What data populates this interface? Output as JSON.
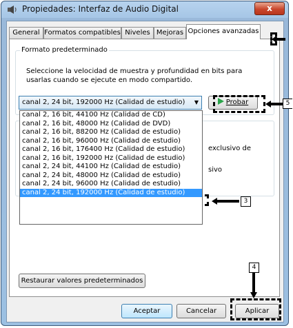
{
  "window": {
    "title": "Propiedades: Interfaz de Audio Digital",
    "close_label": "x"
  },
  "tabs": [
    {
      "label": "General",
      "active": false
    },
    {
      "label": "Formatos compatibles",
      "active": false
    },
    {
      "label": "Niveles",
      "active": false
    },
    {
      "label": "Mejoras",
      "active": false
    },
    {
      "label": "Opciones avanzadas",
      "active": true
    }
  ],
  "default_format": {
    "group_title": "Formato predeterminado",
    "description": "Seleccione la velocidad de muestra y profundidad en bits para usarlas cuando se ejecute en modo compartido.",
    "selected_value": "canal 2, 24 bit, 192000 Hz (Calidad de estudio)",
    "test_button": "Probar",
    "options": [
      "canal 2, 16 bit, 44100 Hz (Calidad de CD)",
      "canal 2, 16 bit, 48000 Hz (Calidad de DVD)",
      "canal 2, 16 bit, 88200 Hz (Calidad de estudio)",
      "canal 2, 16 bit, 96000 Hz (Calidad de estudio)",
      "canal 2, 16 bit, 176400 Hz (Calidad de estudio)",
      "canal 2, 16 bit, 192000 Hz (Calidad de estudio)",
      "canal 2, 24 bit, 44100 Hz (Calidad de estudio)",
      "canal 2, 24 bit, 48000 Hz (Calidad de estudio)",
      "canal 2, 24 bit, 96000 Hz (Calidad de estudio)",
      "canal 2, 24 bit, 192000 Hz (Calidad de estudio)"
    ],
    "selected_index": 9
  },
  "exclusive_mode": {
    "partial_text_1": "exclusivo de",
    "partial_text_2": "sivo"
  },
  "restore_button": "Restaurar valores predeterminados",
  "footer": {
    "ok": "Aceptar",
    "cancel": "Cancelar",
    "apply": "Aplicar"
  },
  "callouts": {
    "c3": "3",
    "c4": "4",
    "c5": "5"
  },
  "colors": {
    "selection": "#3399ff",
    "play_icon": "#2aa54a",
    "close_button": "#c9462c"
  }
}
